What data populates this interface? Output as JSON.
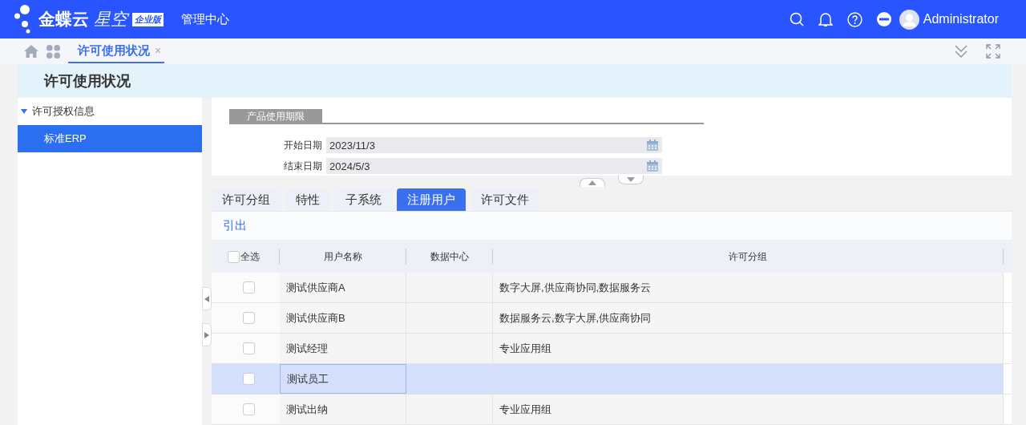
{
  "header": {
    "logo_text": "金蝶云",
    "logo_product": "星空",
    "logo_badge": "企业版",
    "title": "管理中心",
    "user": "Administrator"
  },
  "tabs": [
    {
      "label": "许可使用状况",
      "close": "×",
      "selected": true
    }
  ],
  "page": {
    "title": "许可使用状况"
  },
  "tree": [
    {
      "label": "许可授权信息",
      "expanded": true,
      "selected": false,
      "children": [
        {
          "label": "标准ERP",
          "selected": true
        }
      ]
    }
  ],
  "group": {
    "title": "产品使用期限",
    "fields": [
      {
        "label": "开始日期",
        "value": "2023/11/3"
      },
      {
        "label": "结束日期",
        "value": "2024/5/3"
      }
    ]
  },
  "detail_tabs": [
    {
      "label": "许可分组",
      "selected": false
    },
    {
      "label": "特性",
      "selected": false
    },
    {
      "label": "子系统",
      "selected": false
    },
    {
      "label": "注册用户",
      "selected": true
    },
    {
      "label": "许可文件",
      "selected": false
    }
  ],
  "toolbar": [
    "引出"
  ],
  "table": {
    "select_all": {
      "label": "全选",
      "checked": false
    },
    "columns": [
      "用户名称",
      "数据中心",
      "许可分组"
    ],
    "rows": [
      {
        "user": "测试供应商A",
        "license_group": "数字大屏,供应商协同,数据服务云",
        "checked": false,
        "selected": false
      },
      {
        "user": "测试供应商B",
        "license_group": "数据服务云,数字大屏,供应商协同",
        "checked": false,
        "selected": false
      },
      {
        "user": "测试经理",
        "license_group": "专业应用组",
        "checked": false,
        "selected": false
      },
      {
        "user": "测试员工",
        "checked": false,
        "selected": true
      },
      {
        "user": "测试出纳",
        "license_group": "专业应用组",
        "checked": false,
        "selected": false
      }
    ]
  }
}
